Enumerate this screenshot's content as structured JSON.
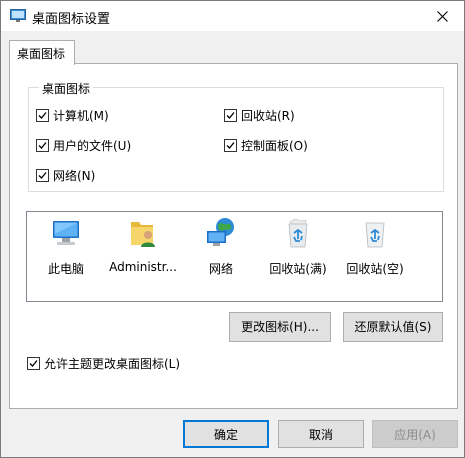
{
  "window": {
    "title": "桌面图标设置"
  },
  "tab": {
    "label": "桌面图标"
  },
  "group": {
    "label": "桌面图标",
    "checkboxes": [
      {
        "label": "计算机(M)",
        "checked": true
      },
      {
        "label": "回收站(R)",
        "checked": true
      },
      {
        "label": "用户的文件(U)",
        "checked": true
      },
      {
        "label": "控制面板(O)",
        "checked": true
      },
      {
        "label": "网络(N)",
        "checked": true
      }
    ]
  },
  "icons": [
    {
      "label": "此电脑",
      "icon": "computer-icon"
    },
    {
      "label": "Administr...",
      "icon": "user-folder-icon"
    },
    {
      "label": "网络",
      "icon": "network-icon"
    },
    {
      "label": "回收站(满)",
      "icon": "recycle-bin-full-icon"
    },
    {
      "label": "回收站(空)",
      "icon": "recycle-bin-empty-icon"
    }
  ],
  "buttons": {
    "change_icon": "更改图标(H)...",
    "restore_default": "还原默认值(S)",
    "ok": "确定",
    "cancel": "取消",
    "apply": "应用(A)"
  },
  "theme_checkbox": {
    "label": "允许主题更改桌面图标(L)",
    "checked": true
  },
  "colors": {
    "accent": "#0078d7",
    "recycle": "#2e8bd6"
  }
}
